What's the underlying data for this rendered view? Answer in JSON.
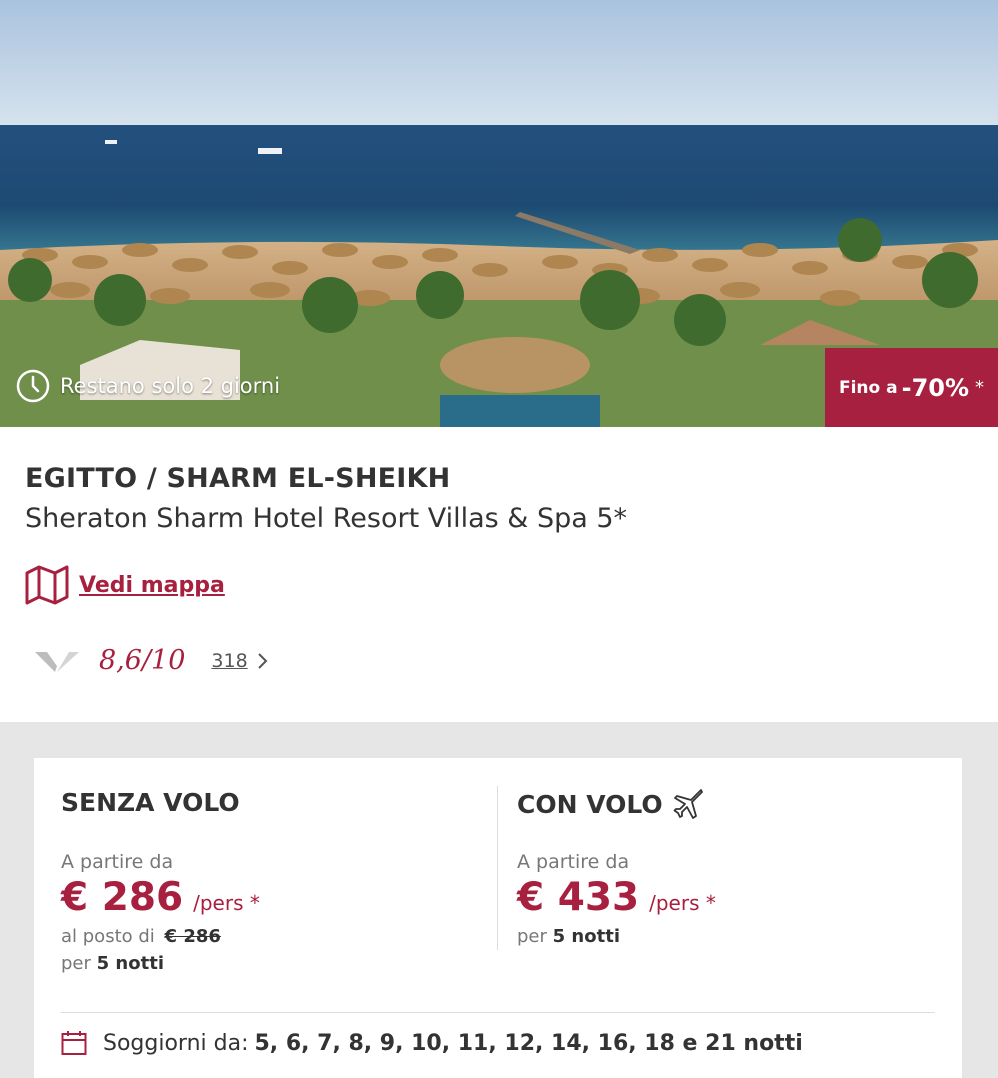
{
  "hero": {
    "countdown": "Restano solo 2 giorni",
    "discount_prefix": "Fino a",
    "discount_value": "-70%",
    "discount_star": "*"
  },
  "hotel": {
    "destination": "EGITTO / SHARM EL-SHEIKH",
    "name": "Sheraton Sharm Hotel Resort Villas & Spa 5*"
  },
  "map": {
    "label": "Vedi mappa"
  },
  "rating": {
    "score": "8,6/10",
    "reviews": "318"
  },
  "offers": {
    "without_flight": {
      "title": "SENZA VOLO",
      "from": "A partire da",
      "price": "€ 286",
      "per_person": "/pers *",
      "instead_label": "al posto di",
      "instead_price": "€ 286",
      "per_label": "per",
      "nights": "5 notti"
    },
    "with_flight": {
      "title": "CON VOLO",
      "from": "A partire da",
      "price": "€ 433",
      "per_person": "/pers *",
      "per_label": "per",
      "nights": "5 notti"
    }
  },
  "stays": {
    "label": "Soggiorni da:",
    "nights": "5, 6, 7, 8, 9, 10, 11, 12, 14, 16, 18 e 21 notti"
  },
  "colors": {
    "accent": "#a8203f",
    "sea": "#1f4f7a",
    "sand": "#c9a77c",
    "panel": "#e6e6e6"
  },
  "icons": [
    "clock-icon",
    "map-icon",
    "review-logo-icon",
    "chevron-right-icon",
    "plane-icon",
    "calendar-icon"
  ]
}
